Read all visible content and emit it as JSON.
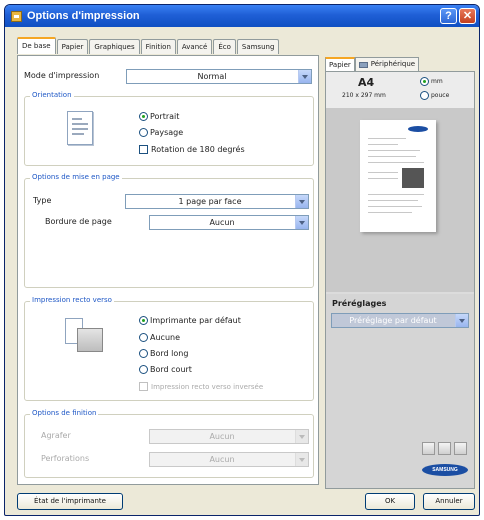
{
  "window": {
    "title": "Options d'impression",
    "help_label": "?",
    "close_label": "✕"
  },
  "tabs": [
    {
      "label": "De base"
    },
    {
      "label": "Papier"
    },
    {
      "label": "Graphiques"
    },
    {
      "label": "Finition"
    },
    {
      "label": "Avancé"
    },
    {
      "label": "Éco"
    },
    {
      "label": "Samsung"
    }
  ],
  "basic": {
    "print_mode_label": "Mode d'impression",
    "print_mode_value": "Normal",
    "orientation": {
      "title": "Orientation",
      "portrait": "Portrait",
      "landscape": "Paysage",
      "rotate": "Rotation de 180 degrés",
      "selected": "portrait"
    },
    "layout": {
      "title": "Options de mise en page",
      "type_label": "Type",
      "type_value": "1 page par face",
      "border_label": "Bordure de page",
      "border_value": "Aucun"
    },
    "duplex": {
      "title": "Impression recto verso",
      "options": [
        "Imprimante par défaut",
        "Aucune",
        "Bord long",
        "Bord court"
      ],
      "selected": "Imprimante par défaut",
      "reverse": "Impression recto verso inversée"
    },
    "finishing": {
      "title": "Options de finition",
      "staple_label": "Agrafer",
      "staple_value": "Aucun",
      "punch_label": "Perforations",
      "punch_value": "Aucun"
    }
  },
  "side_panel": {
    "tab_paper": "Papier",
    "tab_device": "Périphérique",
    "paper_size": "A4",
    "paper_dims": "210 x 297 mm",
    "unit_mm": "mm",
    "unit_inch": "pouce",
    "selected_unit": "mm",
    "presets_title": "Préréglages",
    "presets_value": "Préréglage par défaut",
    "logo_text": "SAMSUNG"
  },
  "footer": {
    "printer_status_label": "État de l'imprimante",
    "ok_label": "OK",
    "cancel_label": "Annuler"
  },
  "colors": {
    "title_bar": "#1f5fd6",
    "accent_tab": "#f5a623",
    "group_title": "#1f58c6",
    "brand": "#1b4ea3"
  }
}
